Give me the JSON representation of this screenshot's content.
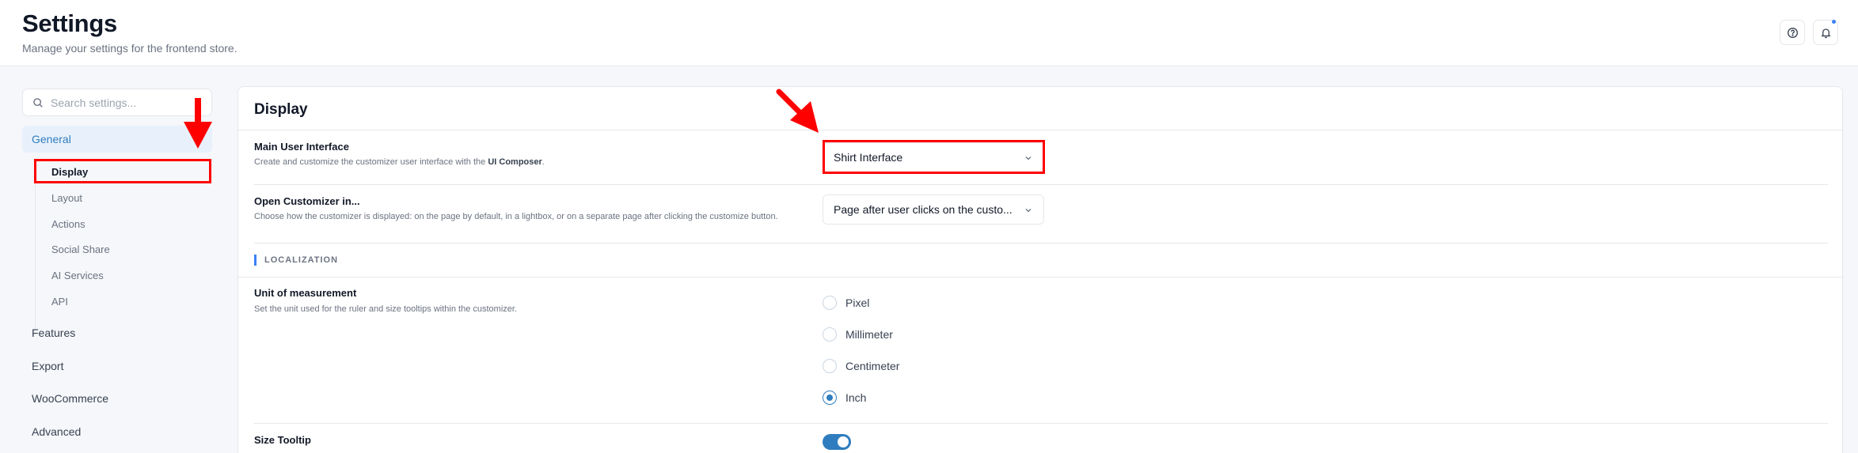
{
  "header": {
    "title": "Settings",
    "subtitle": "Manage your settings for the frontend store.",
    "icons": [
      "help-circle-icon",
      "bell-icon"
    ]
  },
  "sidebar": {
    "search_placeholder": "Search settings...",
    "general_label": "General",
    "sub_items": [
      "Display",
      "Layout",
      "Actions",
      "Social Share",
      "AI Services",
      "API"
    ],
    "active_sub_item": "Display",
    "top_items": [
      "Features",
      "Export",
      "WooCommerce",
      "Advanced"
    ]
  },
  "panel": {
    "title": "Display",
    "main_ui": {
      "label": "Main User Interface",
      "desc_prefix": "Create and customize the customizer user interface with the ",
      "desc_bold": "UI Composer",
      "desc_suffix": ".",
      "value": "Shirt Interface"
    },
    "open_customizer": {
      "label": "Open Customizer in...",
      "desc": "Choose how the customizer is displayed: on the page by default, in a lightbox, or on a separate page after clicking the customize button.",
      "value": "Page after user clicks on the custo..."
    },
    "section_localization": "LOCALIZATION",
    "unit": {
      "label": "Unit of measurement",
      "desc": "Set the unit used for the ruler and size tooltips within the customizer.",
      "options": [
        "Pixel",
        "Millimeter",
        "Centimeter",
        "Inch"
      ],
      "selected": "Inch"
    },
    "size_tooltip": {
      "label": "Size Tooltip",
      "enabled": true
    }
  },
  "colors": {
    "accent": "#2f7dbf",
    "annotation": "#ff0000"
  }
}
